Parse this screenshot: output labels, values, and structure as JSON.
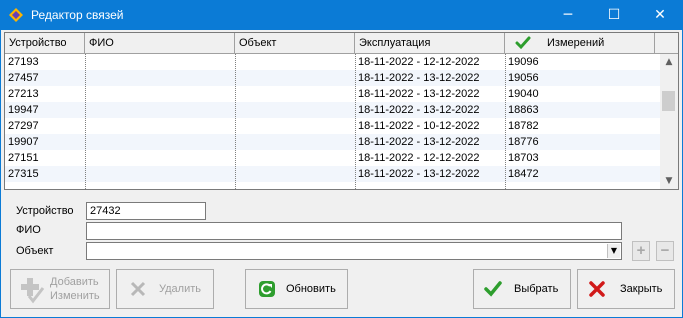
{
  "window": {
    "title": "Редактор связей",
    "minimize": "─",
    "maximize": "☐",
    "close": "✕"
  },
  "grid": {
    "columns": [
      "Устройство",
      "ФИО",
      "Объект",
      "Эксплуатация",
      "Измерений"
    ],
    "rows": [
      [
        "27193",
        "",
        "",
        "18-11-2022 - 12-12-2022",
        "19096"
      ],
      [
        "27457",
        "",
        "",
        "18-11-2022 - 13-12-2022",
        "19056"
      ],
      [
        "27213",
        "",
        "",
        "18-11-2022 - 13-12-2022",
        "19040"
      ],
      [
        "19947",
        "",
        "",
        "18-11-2022 - 13-12-2022",
        "18863"
      ],
      [
        "27297",
        "",
        "",
        "18-11-2022 - 10-12-2022",
        "18782"
      ],
      [
        "19907",
        "",
        "",
        "18-11-2022 - 13-12-2022",
        "18776"
      ],
      [
        "27151",
        "",
        "",
        "18-11-2022 - 12-12-2022",
        "18703"
      ],
      [
        "27315",
        "",
        "",
        "18-11-2022 - 13-12-2022",
        "18472"
      ]
    ]
  },
  "form": {
    "device_label": "Устройство",
    "device_value": "27432",
    "fio_label": "ФИО",
    "fio_value": "",
    "object_label": "Объект",
    "object_value": ""
  },
  "buttons": {
    "add": "Добавить",
    "edit": "Изменить",
    "delete": "Удалить",
    "refresh": "Обновить",
    "select": "Выбрать",
    "close": "Закрыть",
    "plus": "+",
    "minus": "−"
  },
  "icons": [
    "app-icon",
    "check-icon",
    "plus-icon",
    "delete-x-icon",
    "refresh-icon",
    "close-x-icon"
  ],
  "colors": {
    "titlebar": "#0b7bd6",
    "accent_green": "#2e9e2e",
    "accent_red": "#d11a1a"
  }
}
